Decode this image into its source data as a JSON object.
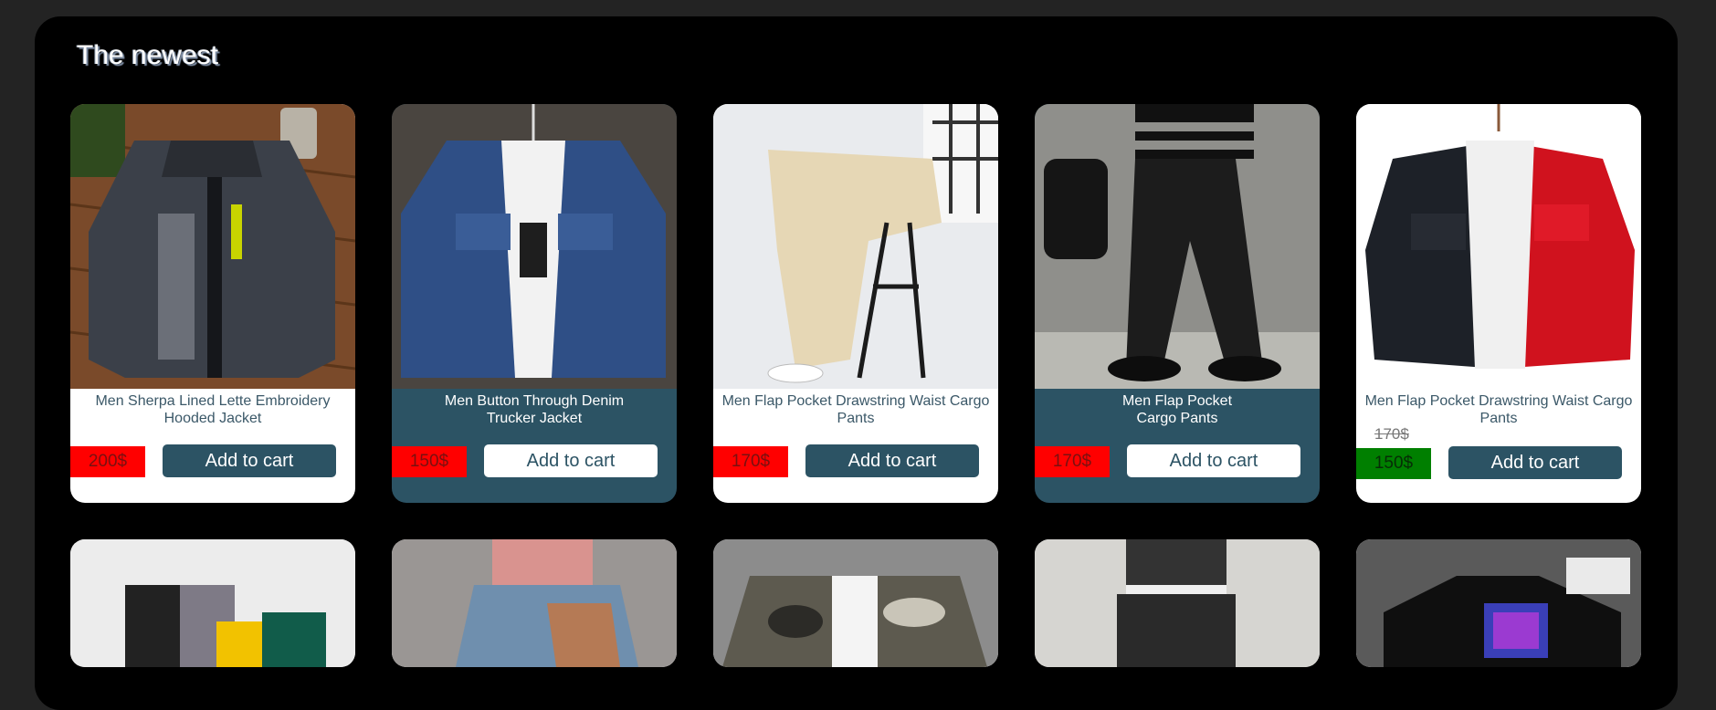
{
  "section": {
    "title": "The newest"
  },
  "colors": {
    "accent_dark": "#2c5364",
    "price_red": "#ff0000",
    "price_sale_green": "#007f00"
  },
  "products": [
    {
      "name_line1": "Men Sherpa Lined Lette Embroidery",
      "name_line2": "Hooded Jacket",
      "price": "200$",
      "old_price": "",
      "button": "Add to cart",
      "theme": "light"
    },
    {
      "name_line1": "Men Button Through Denim",
      "name_line2": "Trucker Jacket",
      "price": "150$",
      "old_price": "",
      "button": "Add to cart",
      "theme": "dark"
    },
    {
      "name_line1": "Men Flap Pocket Drawstring Waist Cargo",
      "name_line2": "Pants",
      "price": "170$",
      "old_price": "",
      "button": "Add to cart",
      "theme": "light"
    },
    {
      "name_line1": "Men Flap Pocket",
      "name_line2": "Cargo Pants",
      "price": "170$",
      "old_price": "",
      "button": "Add to cart",
      "theme": "dark"
    },
    {
      "name_line1": "Men Flap Pocket Drawstring Waist Cargo",
      "name_line2": "Pants",
      "price": "150$",
      "old_price": "170$",
      "button": "Add to cart",
      "theme": "light"
    }
  ],
  "row2_images": [
    "colorblock-pants-photo",
    "patched-jeans-photo",
    "camo-hoodie-photo",
    "cargo-pants-photo",
    "graphic-tshirt-photo"
  ]
}
